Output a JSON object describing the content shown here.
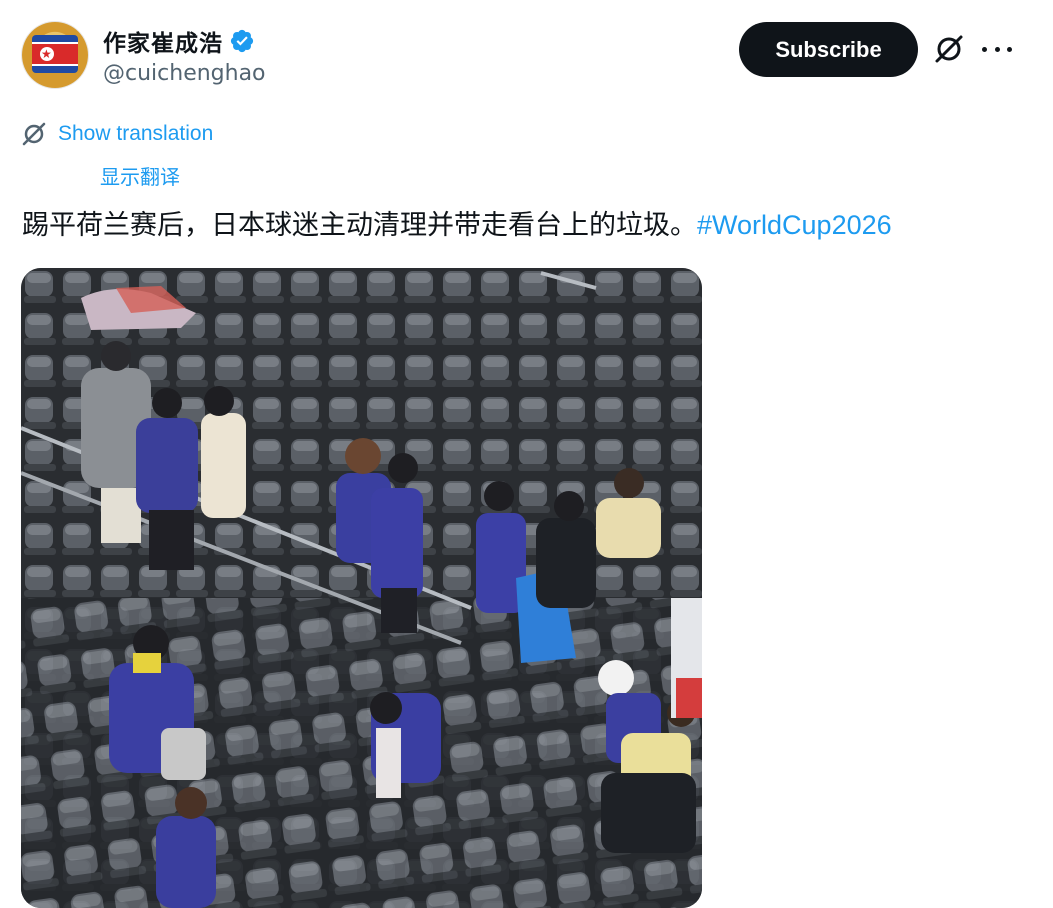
{
  "author": {
    "display_name": "作家崔成浩",
    "handle": "@cuichenghao",
    "verified": true,
    "avatar_icon": "north-korea-flag-emblem"
  },
  "actions": {
    "subscribe_label": "Subscribe",
    "grok_icon": "grok-icon",
    "more_icon": "more-dots-icon"
  },
  "translation": {
    "show_translation": "Show translation",
    "show_translation_cn": "显示翻译"
  },
  "tweet": {
    "text": "踢平荷兰赛后，日本球迷主动清理并带走看台上的垃圾。",
    "hashtag": "#WorldCup2026"
  },
  "colors": {
    "accent": "#1d9bf0",
    "text": "#0f1419",
    "secondary_text": "#536471",
    "button_bg": "#0f1419"
  },
  "media": {
    "description_icon": "stadium-photo"
  }
}
